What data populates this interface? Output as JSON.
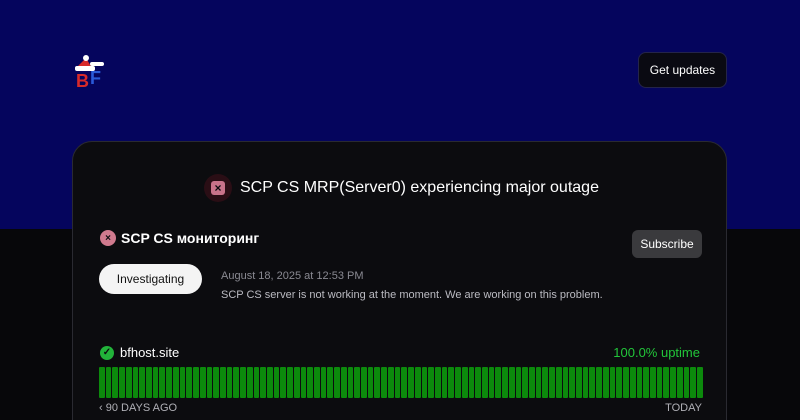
{
  "header": {
    "logo_text": "BF",
    "get_updates_label": "Get updates"
  },
  "banner": {
    "text": "SCP CS MRP(Server0) experiencing major outage"
  },
  "component": {
    "name": "SCP CS мониторинг",
    "subscribe_label": "Subscribe",
    "incident": {
      "status": "Investigating",
      "timestamp": "August 18, 2025 at 12:53 PM",
      "message": "SCP CS server is not working at the moment. We are working on this problem."
    }
  },
  "monitor": {
    "name": "bfhost.site",
    "uptime": "100.0% uptime",
    "range_start": "90 DAYS AGO",
    "range_end": "TODAY",
    "days": 90,
    "bar_color": "#0c8a0c"
  },
  "colors": {
    "hero_bg": "#05055d",
    "page_bg": "#07070a",
    "outage": "#d07a8e",
    "operational": "#22c63a"
  }
}
